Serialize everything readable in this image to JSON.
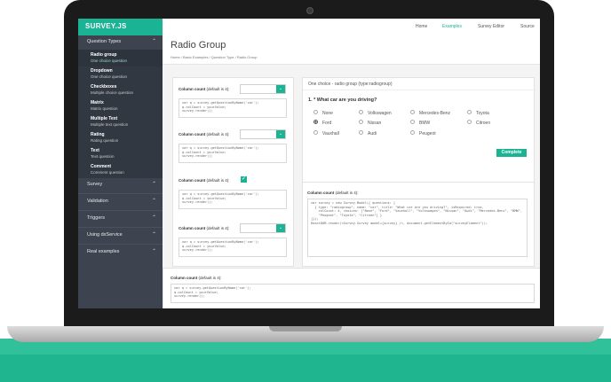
{
  "brand": "SURVEY.JS",
  "topnav": [
    "Home",
    "Examples",
    "Survey Editor",
    "Source"
  ],
  "page_title": "Radio Group",
  "breadcrumb": "Home  /  Basic Examples  /  Question Type  /  Radio Group",
  "sidebar": {
    "question_types": "Question Types",
    "items": [
      {
        "title": "Radio group",
        "sub": "One choice question"
      },
      {
        "title": "Dropdown",
        "sub": "One choice question"
      },
      {
        "title": "Checkboxes",
        "sub": "Multiple choice question"
      },
      {
        "title": "Matrix",
        "sub": "Matrix question"
      },
      {
        "title": "Multiple Text",
        "sub": "Multiple text question"
      },
      {
        "title": "Rating",
        "sub": "Rating question"
      },
      {
        "title": "Text",
        "sub": "Text question"
      },
      {
        "title": "Comment",
        "sub": "Comment question"
      }
    ],
    "sections": [
      "Survey",
      "Validation",
      "Triggers",
      "Using dxService",
      "Real examples"
    ]
  },
  "column_count_label": "Column count",
  "column_count_hint": "(default is 4):",
  "code_small": "var q = survey.getQuestionByName('car');\nq.colCount = yourValue;\nsurvey.render();",
  "survey": {
    "header": "One choice - radio group (type:radiogroup)",
    "question": "1. * What car are you driving?",
    "options": [
      "None",
      "Volkswagen",
      "Mercedes-Benz",
      "Toyota",
      "Ford",
      "Nissan",
      "BMW",
      "Citroen",
      "Vauxhall",
      "Audi",
      "Peugeot"
    ],
    "selected": "Ford",
    "complete": "Complete"
  },
  "code_big": "var survey = new Survey.Model({ questions: [\n  { type: \"radiogroup\", name: \"car\", title: \"What car are you driving?\", isRequired: true,\n    colCount: 4, choices: [\"None\", \"Ford\", \"Vauxhall\", \"Volkswagen\", \"Nissan\", \"Audi\", \"Mercedes-Benz\", \"BMW\",\n    \"Peugeot\", \"Toyota\", \"Citroen\"] }\n]});\nReactDOM.render(<Survey.Survey model={survey} />, document.getElementById(\"surveyElement\"));"
}
